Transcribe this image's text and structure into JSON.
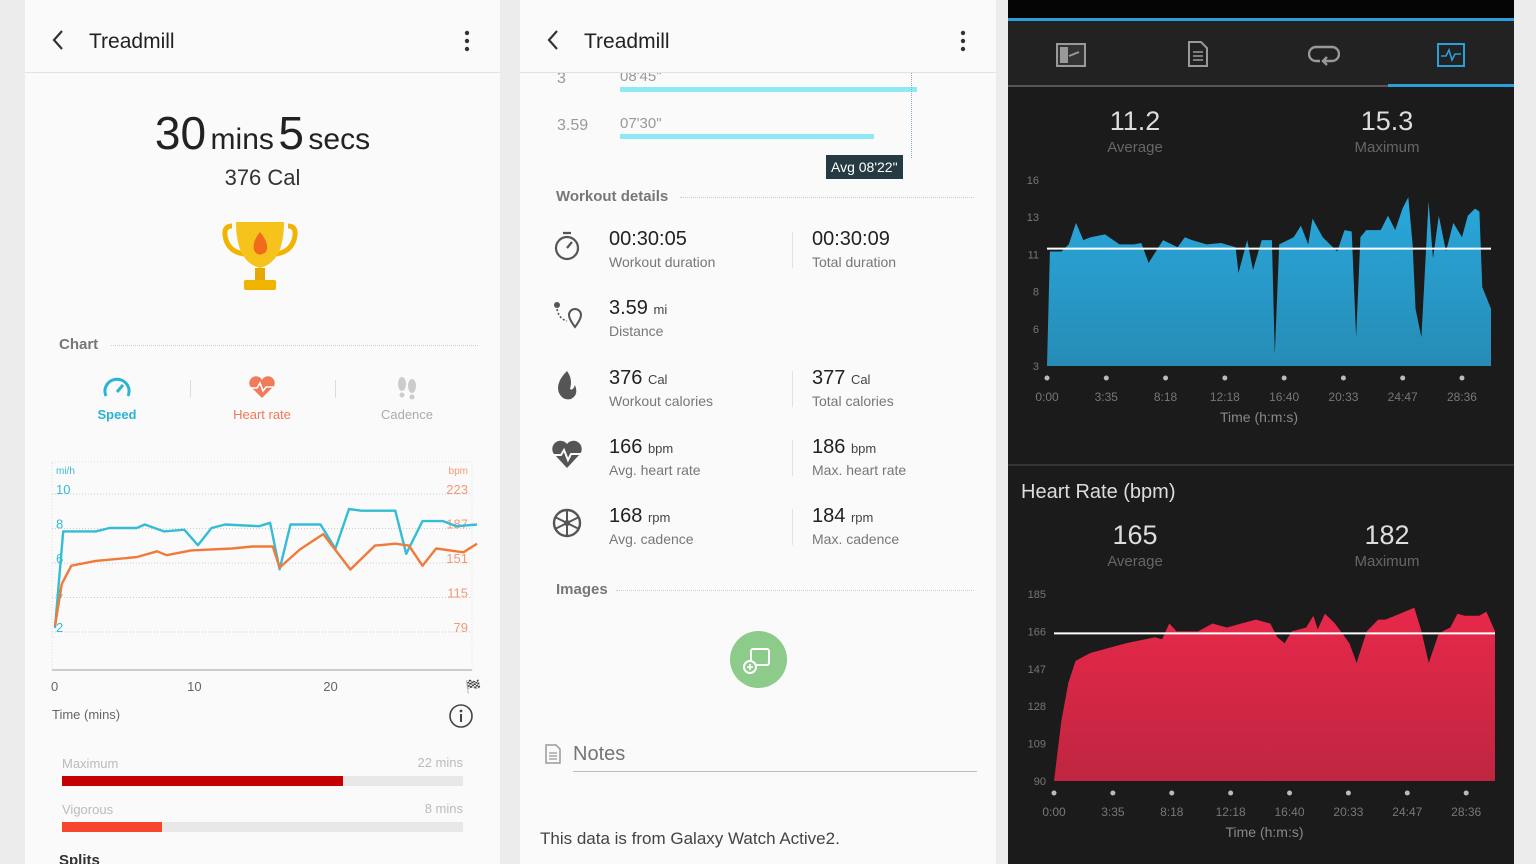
{
  "left": {
    "header": {
      "title": "Treadmill"
    },
    "duration": {
      "mins": "30",
      "mins_unit": "mins",
      "secs": "5",
      "secs_unit": "secs"
    },
    "calories": "376 Cal",
    "chart_section": "Chart",
    "tabs": [
      {
        "label": "Speed",
        "icon": "speedometer-icon",
        "color": "#2ab4d2",
        "active": true
      },
      {
        "label": "Heart rate",
        "icon": "heart-rate-icon",
        "color": "#f07a5a"
      },
      {
        "label": "Cadence",
        "icon": "footsteps-icon",
        "color": "#aaaaaa"
      }
    ],
    "x_axis_title": "Time (mins)",
    "zones": [
      {
        "label": "Maximum",
        "value": "22 mins",
        "fraction": 0.7,
        "color": "#c40000"
      },
      {
        "label": "Vigorous",
        "value": "8 mins",
        "fraction": 0.25,
        "color": "#f4472d"
      }
    ],
    "splits_section": "Splits"
  },
  "mid": {
    "header": {
      "title": "Treadmill"
    },
    "splits": [
      {
        "mile": "3",
        "pace": "08'45\"",
        "fraction": 0.97
      },
      {
        "mile": "3.59",
        "pace": "07'30\"",
        "fraction": 0.83
      }
    ],
    "avg_pace": "Avg 08'22\"",
    "workout_section": "Workout details",
    "details": [
      {
        "icon": "stopwatch-icon",
        "a_value": "00:30:05",
        "a_unit": "",
        "a_label": "Workout duration",
        "b_value": "00:30:09",
        "b_unit": "",
        "b_label": "Total duration"
      },
      {
        "icon": "route-icon",
        "a_value": "3.59",
        "a_unit": "mi",
        "a_label": "Distance"
      },
      {
        "icon": "flame-icon",
        "a_value": "376",
        "a_unit": "Cal",
        "a_label": "Workout calories",
        "b_value": "377",
        "b_unit": "Cal",
        "b_label": "Total calories"
      },
      {
        "icon": "heart-rate-icon",
        "a_value": "166",
        "a_unit": "bpm",
        "a_label": "Avg. heart rate",
        "b_value": "186",
        "b_unit": "bpm",
        "b_label": "Max. heart rate"
      },
      {
        "icon": "cadence-wheel-icon",
        "a_value": "168",
        "a_unit": "rpm",
        "a_label": "Avg. cadence",
        "b_value": "184",
        "b_unit": "rpm",
        "b_label": "Max. cadence"
      }
    ],
    "images_section": "Images",
    "notes_placeholder": "Notes",
    "source_note": "This data is from Galaxy Watch Active2."
  },
  "right": {
    "tabs": [
      {
        "icon": "map-summary-icon"
      },
      {
        "icon": "document-icon"
      },
      {
        "icon": "laps-icon"
      },
      {
        "icon": "charts-icon",
        "active": true
      }
    ],
    "speed_stats": {
      "average": "11.2",
      "average_label": "Average",
      "maximum": "15.3",
      "maximum_label": "Maximum"
    },
    "hr_title": "Heart Rate (bpm)",
    "hr_stats": {
      "average": "165",
      "average_label": "Average",
      "maximum": "182",
      "maximum_label": "Maximum"
    },
    "accent": "#2a9fd8"
  },
  "chart_data": [
    {
      "type": "line",
      "x_label": "Time (mins)",
      "x_ticks": [
        "0",
        "10",
        "20"
      ],
      "xlim": [
        0,
        31
      ],
      "left_axis": {
        "unit": "mi/h",
        "ticks": [
          "2",
          "4",
          "6",
          "8",
          "10"
        ],
        "ylim": [
          2,
          10
        ]
      },
      "right_axis": {
        "unit": "bpm",
        "ticks": [
          "79",
          "115",
          "151",
          "187",
          "223"
        ],
        "ylim": [
          79,
          223
        ]
      },
      "grid": true,
      "series": [
        {
          "axis": "left",
          "color": "#34bdd3",
          "x": [
            0,
            0.6,
            1,
            3,
            4,
            6,
            6.6,
            8,
            9.5,
            10.5,
            11.5,
            12.5,
            15,
            15.8,
            16.5,
            17.3,
            19.5,
            20.6,
            21.6,
            22.5,
            25,
            25.8,
            27,
            28.5,
            29.5,
            31
          ],
          "y": [
            2,
            7.6,
            7.6,
            7.6,
            7.8,
            7.8,
            8.0,
            7.6,
            7.7,
            6.8,
            7.8,
            8.0,
            7.9,
            8.1,
            5.4,
            8.0,
            8.0,
            6.6,
            8.9,
            8.8,
            8.8,
            6.3,
            8.2,
            8.2,
            7.9,
            8.0
          ]
        },
        {
          "axis": "right",
          "color": "#f07a3a",
          "x": [
            0,
            0.5,
            1.2,
            3,
            6,
            7.5,
            8.2,
            10,
            13,
            14.5,
            16,
            16.5,
            18,
            19.7,
            21.7,
            23.5,
            25,
            26,
            27,
            28,
            30,
            31
          ],
          "y": [
            81,
            125,
            144,
            149,
            153,
            159,
            155,
            160,
            162,
            164,
            164,
            142,
            161,
            177,
            140,
            165,
            167,
            165,
            144,
            162,
            158,
            167
          ]
        }
      ]
    },
    {
      "type": "area",
      "x_label": "Time (h:m:s)",
      "x_ticks": [
        "0:00",
        "3:35",
        "8:18",
        "12:18",
        "16:40",
        "20:33",
        "24:47",
        "28:36"
      ],
      "y_ticks": [
        "3",
        "6",
        "8",
        "11",
        "13",
        "16"
      ],
      "ylim": [
        3,
        16
      ],
      "xlim": [
        0,
        30.6
      ],
      "average_line": 11.2,
      "color": "#29a8dc",
      "x": [
        0,
        0.2,
        1,
        1.5,
        2,
        2.5,
        3,
        4,
        5,
        6,
        6.5,
        7,
        8,
        9,
        9.5,
        10,
        11,
        12,
        13,
        13.2,
        13.8,
        14.2,
        14.8,
        15.5,
        15.7,
        16,
        17,
        17.5,
        18,
        18.3,
        19,
        20,
        20.5,
        21,
        21.3,
        21.6,
        22,
        23,
        23.5,
        24,
        24.5,
        24.9,
        25.2,
        25.4,
        25.8,
        26.3,
        26.6,
        27,
        27.5,
        28,
        28.6,
        29,
        29.5,
        29.8,
        30,
        30.6
      ],
      "y": [
        3,
        11,
        11,
        11.5,
        13,
        11.8,
        12,
        12.2,
        11.5,
        11.5,
        11.6,
        10.2,
        11.8,
        11.3,
        12,
        11.8,
        11.5,
        11.6,
        11.3,
        9.5,
        11.8,
        9.7,
        11.8,
        11.8,
        3.8,
        11.5,
        12,
        12.8,
        11.5,
        13.3,
        12,
        11,
        12.5,
        12.4,
        5,
        12,
        12.5,
        12.5,
        13.5,
        12.5,
        14,
        14.8,
        11.5,
        7,
        5,
        14.5,
        10.5,
        13.5,
        11,
        13,
        12,
        13.5,
        14,
        13.8,
        8.5,
        7
      ]
    },
    {
      "type": "area",
      "title": "Heart Rate (bpm)",
      "x_label": "Time (h:m:s)",
      "x_ticks": [
        "0:00",
        "3:35",
        "8:18",
        "12:18",
        "16:40",
        "20:33",
        "24:47",
        "28:36"
      ],
      "y_ticks": [
        "90",
        "109",
        "128",
        "147",
        "166",
        "185"
      ],
      "ylim": [
        90,
        185
      ],
      "xlim": [
        0,
        30.6
      ],
      "average_line": 165,
      "color": "#e8284a",
      "x": [
        0,
        0.5,
        1,
        1.5,
        2.5,
        3.5,
        5,
        7,
        7.5,
        8,
        8.5,
        10,
        11,
        12,
        13,
        14,
        15,
        15.5,
        16,
        16.5,
        17.5,
        18,
        18.3,
        18.8,
        19.5,
        20.5,
        21,
        21.7,
        22.5,
        23,
        24,
        25,
        25.5,
        26,
        26.7,
        27.5,
        28,
        28.5,
        29.5,
        30,
        30.6
      ],
      "y": [
        90,
        120,
        140,
        151,
        155,
        157,
        160,
        163,
        162,
        170,
        166,
        166,
        170,
        168,
        170,
        172,
        170,
        163,
        160,
        166,
        168,
        174,
        167,
        175,
        170,
        160,
        150,
        166,
        172,
        172,
        175,
        178,
        166,
        150,
        165,
        168,
        175,
        174,
        174,
        176,
        166
      ]
    }
  ]
}
